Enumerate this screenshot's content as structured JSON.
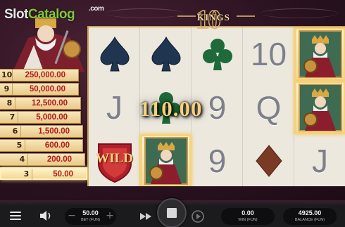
{
  "watermark": {
    "slot": "Slot",
    "catalog": "Catalog",
    "com": ".com"
  },
  "logo": {
    "ten": "10",
    "kings": "KINGS"
  },
  "paytable": [
    {
      "level": "10",
      "value": "250,000.00",
      "active": false
    },
    {
      "level": "9",
      "value": "50,000.00",
      "active": false
    },
    {
      "level": "8",
      "value": "12,500.00",
      "active": false
    },
    {
      "level": "7",
      "value": "5,000.00",
      "active": false
    },
    {
      "level": "6",
      "value": "1,500.00",
      "active": false
    },
    {
      "level": "5",
      "value": "600.00",
      "active": false
    },
    {
      "level": "4",
      "value": "200.00",
      "active": false
    },
    {
      "level": "3",
      "value": "50.00",
      "active": true
    }
  ],
  "reels": [
    [
      "spade-symbol",
      "J",
      "wild-symbol"
    ],
    [
      "spade-symbol",
      "club-symbol",
      "king-symbol"
    ],
    [
      "club-symbol",
      "9",
      "9"
    ],
    [
      "10",
      "Q",
      "diamond-symbol"
    ],
    [
      "king-symbol",
      "king-symbol",
      "J"
    ]
  ],
  "win_amount": "110.00",
  "wild_label": "WILD",
  "controls": {
    "bet_value": "50.00",
    "bet_label": "BET (FUN)",
    "bet_minus": "−",
    "bet_plus": "+",
    "win_value": "0.00",
    "win_label": "WIN (FUN)",
    "balance_value": "4925.00",
    "balance_label": "BALANCE (FUN)"
  },
  "colors": {
    "paytable_value": "#b41a1a",
    "win_text": "#f4d17a",
    "reel_background": "#ece8de",
    "watermark_green": "#7fc53a"
  }
}
